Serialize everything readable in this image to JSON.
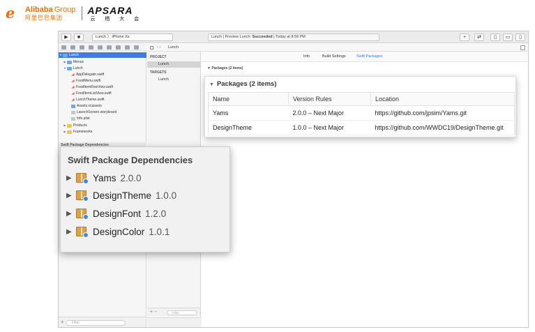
{
  "header": {
    "alibaba_en": "Alibaba",
    "alibaba_group": "Group",
    "alibaba_cn": "阿里巴巴集团",
    "apsara_en": "APSARA",
    "apsara_cn": "云 栖 大 会"
  },
  "toolbar": {
    "scheme_label": "Lunch 〉 iPhone Xs",
    "status_prefix": "Lunch | Preview Lunch: ",
    "status_state": "Succeeded",
    "status_suffix": " | Today at 8:59 PM",
    "plus_label": "+"
  },
  "navigator": {
    "root": "Lunch",
    "items": [
      {
        "label": "Menus",
        "kind": "folder"
      },
      {
        "label": "Lunch",
        "kind": "folder-open"
      },
      {
        "label": "AppDelegate.swift",
        "kind": "swift"
      },
      {
        "label": "FoodMenu.swift",
        "kind": "swift"
      },
      {
        "label": "FoodItemRowView.swift",
        "kind": "swift"
      },
      {
        "label": "FoodItemListView.swift",
        "kind": "swift"
      },
      {
        "label": "LunchTheme.swift",
        "kind": "swift"
      },
      {
        "label": "Assets.xcassets",
        "kind": "asset"
      },
      {
        "label": "LaunchScreen.storyboard",
        "kind": "plist"
      },
      {
        "label": "Info.plist",
        "kind": "plist"
      },
      {
        "label": "Products",
        "kind": "folder-y"
      },
      {
        "label": "Frameworks",
        "kind": "folder-y"
      }
    ],
    "section_label": "Swift Package Dependencies",
    "filter_placeholder": "Filter"
  },
  "jumpbar": {
    "crumb": "Lunch"
  },
  "project_panel": {
    "project_header": "PROJECT",
    "project_item": "Lunch",
    "targets_header": "TARGETS",
    "target_item": "Lunch",
    "filter_placeholder": "Filter"
  },
  "editor": {
    "tabs": [
      "Info",
      "Build Settings",
      "Swift Packages"
    ],
    "packages_small": "Packages (2 items)"
  },
  "packages_zoom": {
    "title": "Packages (2 items)",
    "columns": [
      "Name",
      "Version Rules",
      "Location"
    ],
    "rows": [
      {
        "name": "Yams",
        "rule": "2.0.0 – Next Major",
        "location": "https://github.com/jpsim/Yams.git"
      },
      {
        "name": "DesignTheme",
        "rule": "1.0.0 – Next Major",
        "location": "https://github.com/WWDC19/DesignTheme.git"
      }
    ]
  },
  "dependencies_zoom": {
    "title": "Swift Package Dependencies",
    "items": [
      {
        "name": "Yams",
        "version": "2.0.0"
      },
      {
        "name": "DesignTheme",
        "version": "1.0.0"
      },
      {
        "name": "DesignFont",
        "version": "1.2.0"
      },
      {
        "name": "DesignColor",
        "version": "1.0.1"
      }
    ]
  },
  "colors": {
    "alibaba_orange": "#ff6a00",
    "selection_blue": "#3d7fe0",
    "tab_active": "#2f7de1"
  }
}
